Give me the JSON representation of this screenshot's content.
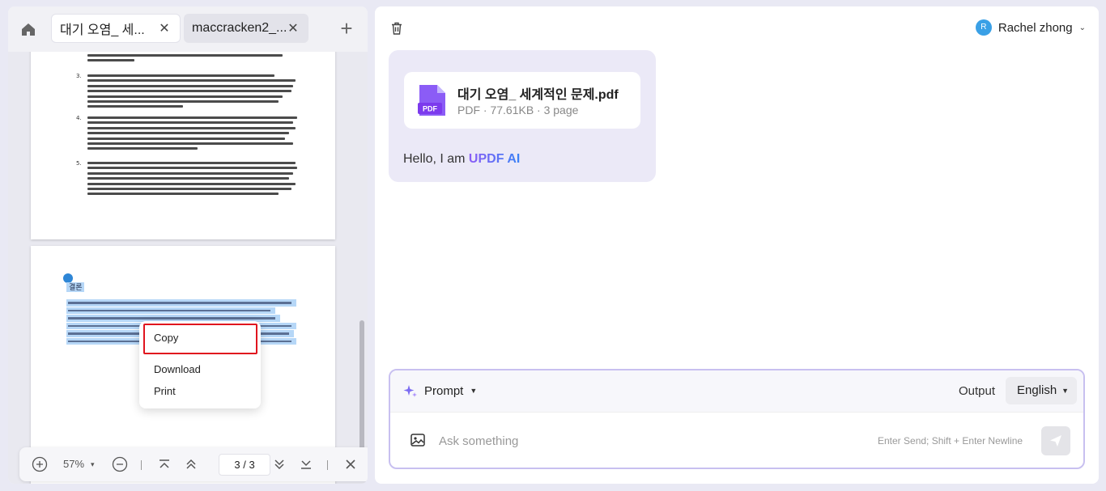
{
  "tabs": [
    {
      "label": "대기 오염_ 세...",
      "active": true
    },
    {
      "label": "maccracken2_...",
      "active": false
    }
  ],
  "icons": {
    "home": "home-icon",
    "close": "close-icon",
    "add": "plus-icon",
    "trash": "trash-icon",
    "pdf": "pdf-file-icon",
    "sparkle": "sparkle-icon",
    "image": "image-icon",
    "send": "send-icon"
  },
  "document": {
    "list_numbers": [
      "3.",
      "4.",
      "5."
    ],
    "heading_selected": "결론"
  },
  "context_menu": {
    "items": [
      "Copy",
      "Download",
      "Print"
    ]
  },
  "toolbar": {
    "zoom": "57%",
    "page_current": "3",
    "page_sep": "/",
    "page_total": "3"
  },
  "user": {
    "initial": "R",
    "name": "Rachel zhong"
  },
  "chat": {
    "file_name": "대기 오염_ 세계적인 문제.pdf",
    "file_meta": "PDF · 77.61KB · 3 page",
    "greeting_prefix": "Hello, I am ",
    "greeting_brand": "UPDF AI"
  },
  "composer": {
    "prompt_label": "Prompt",
    "output_label": "Output",
    "language": "English",
    "placeholder": "Ask something",
    "hint": "Enter Send; Shift + Enter Newline"
  },
  "colors": {
    "accent_purple": "#8b5cf6",
    "brand_blue": "#3b82f6",
    "highlight_red": "#e0141e",
    "selection_blue": "#b6d7f7"
  }
}
